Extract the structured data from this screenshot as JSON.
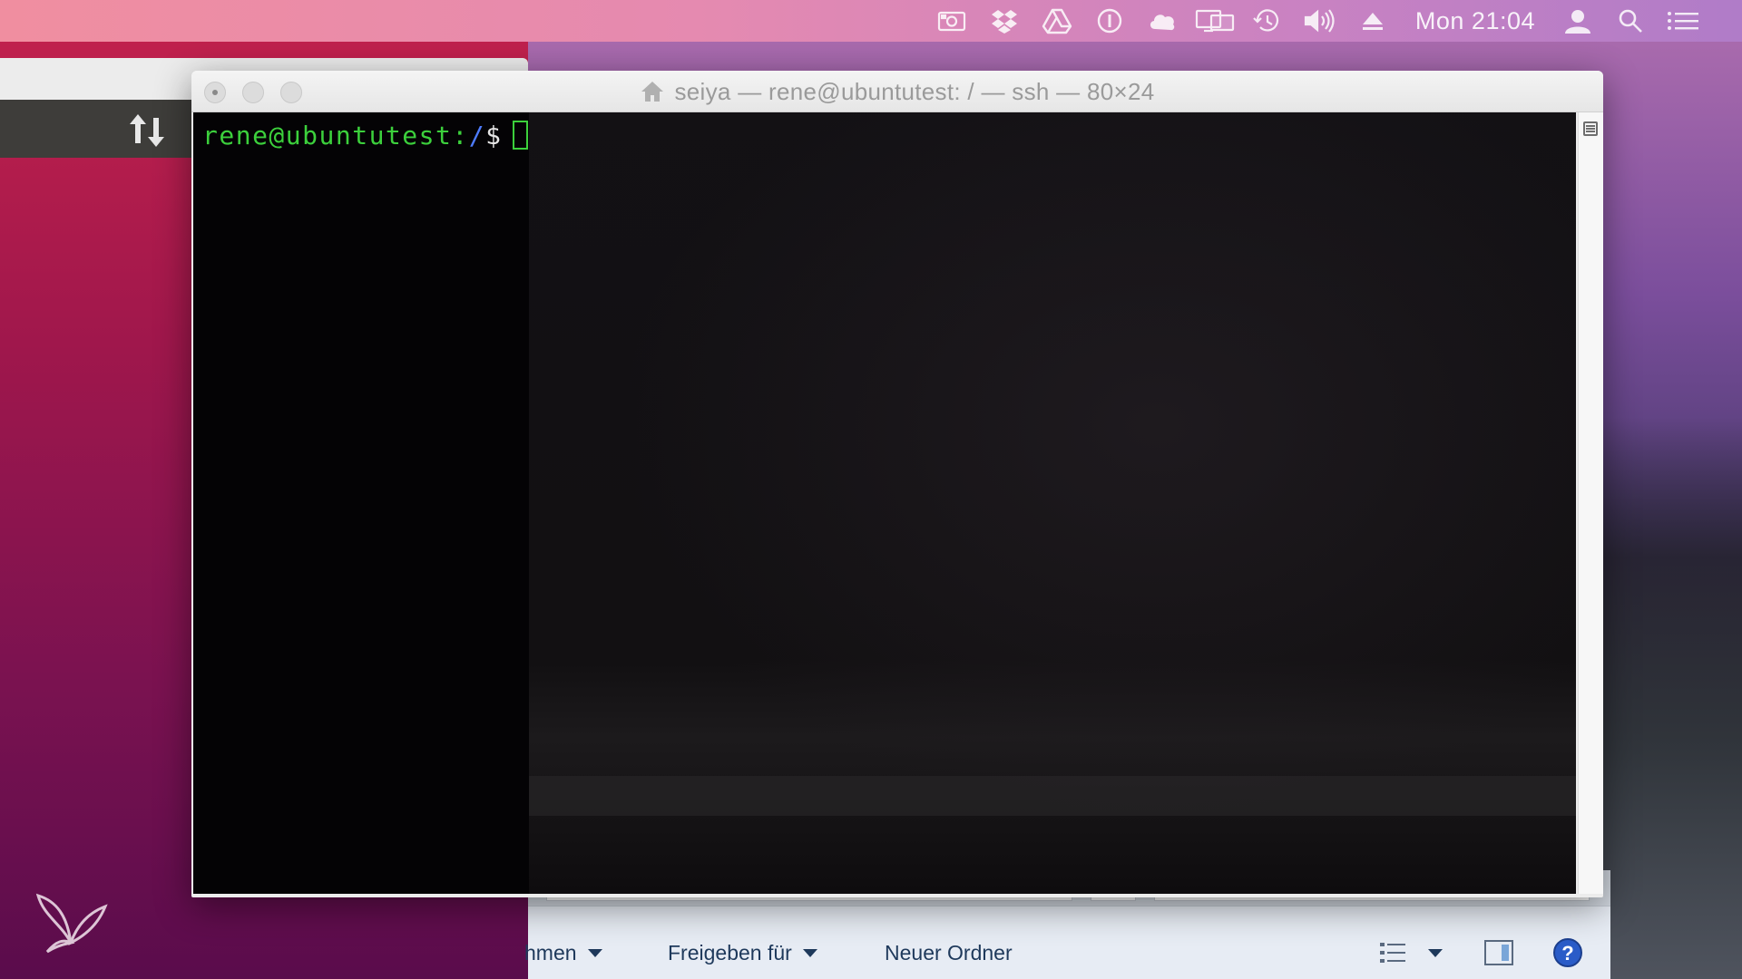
{
  "menubar": {
    "icons": [
      "screen-capture-icon",
      "dropbox-icon",
      "google-drive-icon",
      "password-manager-icon",
      "cloud-sync-icon",
      "display-mirroring-icon",
      "time-machine-icon",
      "volume-icon",
      "eject-icon"
    ],
    "clock": "Mon 21:04",
    "right_icons": [
      "user-icon",
      "spotlight-search-icon",
      "notification-center-icon"
    ]
  },
  "terminal": {
    "title": "seiya — rene@ubuntutest: / — ssh — 80×24",
    "prompt_user": "rene@ubuntutest",
    "prompt_colon": ":",
    "prompt_path": "/",
    "prompt_dollar": "$"
  },
  "explorer": {
    "toolbar": {
      "item1_label": "hmen",
      "share_label": "Freigeben für",
      "new_folder_label": "Neuer Ordner"
    }
  },
  "colors": {
    "prompt_user": "#3cd03c",
    "prompt_path": "#4e7cff",
    "terminal_bg": "#0e0c0f"
  }
}
